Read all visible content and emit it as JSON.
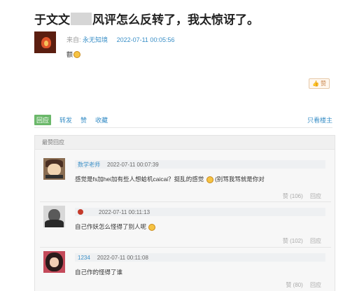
{
  "post": {
    "title_part1": "于文文",
    "title_part2": "风评怎么反转了，我太惊讶了。",
    "source_label": "来自:",
    "author": "永无知境",
    "time": "2022-07-11 00:05:56",
    "body": "额",
    "like_button": "赞"
  },
  "actions": {
    "reply": "回应",
    "repost": "转发",
    "like": "赞",
    "collect": "收藏",
    "only_op": "只看楼主"
  },
  "best_replies": {
    "header": "最赞回应",
    "items": [
      {
        "name": "数学老师",
        "time": "2022-07-11 00:07:39",
        "content_a": "感觉是fs加hei加有些人想蛤机caicai？挺乱的感觉",
        "content_b": "(别骂我骂就是你对",
        "likes": "赞 (106)",
        "reply": "回应"
      },
      {
        "name": "",
        "time": "2022-07-11 00:11:13",
        "content_a": "自己作妖怎么怪得了别人呢",
        "content_b": "",
        "likes": "赞 (102)",
        "reply": "回应"
      },
      {
        "name": "1234",
        "time": "2022-07-11 00:11:08",
        "content_a": "自己作的怪得了谁",
        "content_b": "",
        "likes": "赞 (80)",
        "reply": "回应"
      }
    ]
  }
}
